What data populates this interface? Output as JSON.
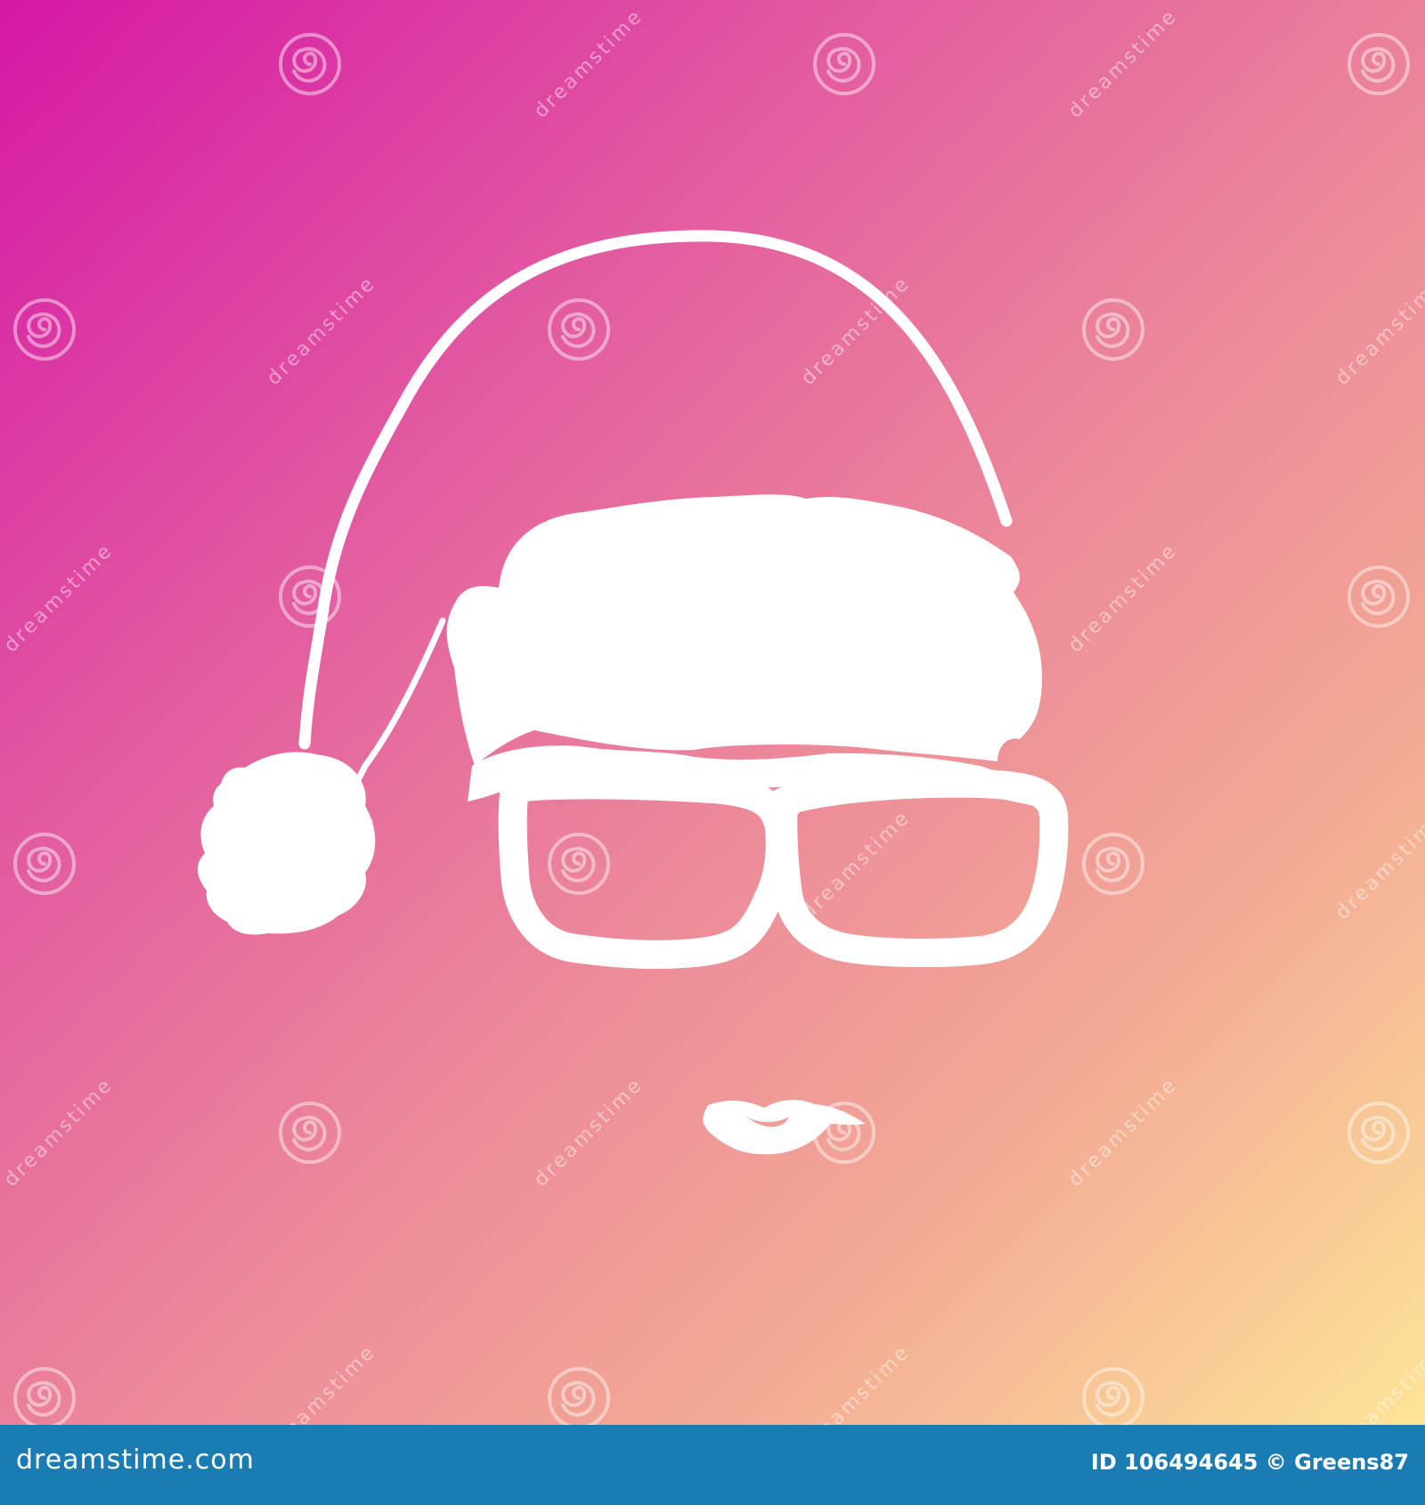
{
  "illustration": {
    "background_colors": [
      "#d517a6",
      "#e35ea0",
      "#ec8a99",
      "#f3a995",
      "#fde497"
    ],
    "figure_color": "#ffffff",
    "elements": [
      "santa-hat",
      "pompom",
      "hair",
      "sunglasses",
      "lips"
    ]
  },
  "watermark": {
    "text": "dreamstime",
    "icon": "swirl-icon"
  },
  "footer": {
    "logo_text": "dreamstime.com",
    "id_text": "ID 106494645 © Greens87",
    "background_color": "#1b7cb3"
  }
}
